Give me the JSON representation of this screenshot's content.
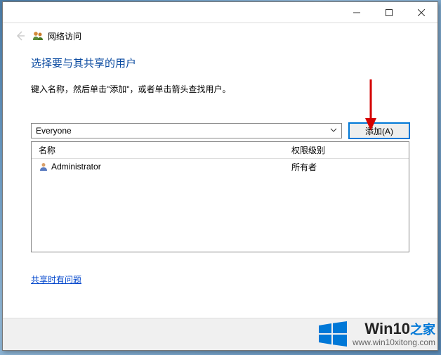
{
  "window": {
    "app_title": "网络访问"
  },
  "content": {
    "heading": "选择要与其共享的用户",
    "subtext": "键入名称，然后单击\"添加\"，或者单击箭头查找用户。",
    "user_select_value": "Everyone",
    "add_button_label": "添加(A)"
  },
  "table": {
    "header": {
      "name": "名称",
      "permission": "权限级别"
    },
    "rows": [
      {
        "name": "Administrator",
        "permission": "所有者"
      }
    ]
  },
  "links": {
    "help": "共享时有问题"
  },
  "watermark": {
    "brand": "Win10",
    "brand_zh": "之家",
    "url": "www.win10xitong.com"
  }
}
